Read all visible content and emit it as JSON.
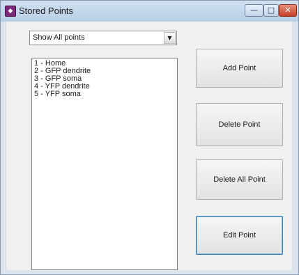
{
  "window": {
    "title": "Stored Points",
    "app_icon": "app-icon",
    "controls": {
      "minimize": "—",
      "maximize": "□",
      "close": "✕"
    }
  },
  "filter": {
    "selected": "Show All points",
    "arrow": "▼"
  },
  "points": [
    {
      "label": "1 - Home"
    },
    {
      "label": "2 - GFP dendrite"
    },
    {
      "label": "3 - GFP soma"
    },
    {
      "label": "4 - YFP dendrite"
    },
    {
      "label": "5 - YFP soma"
    }
  ],
  "buttons": {
    "add": "Add Point",
    "delete": "Delete Point",
    "delete_all": "Delete All Point",
    "edit": "Edit Point"
  }
}
